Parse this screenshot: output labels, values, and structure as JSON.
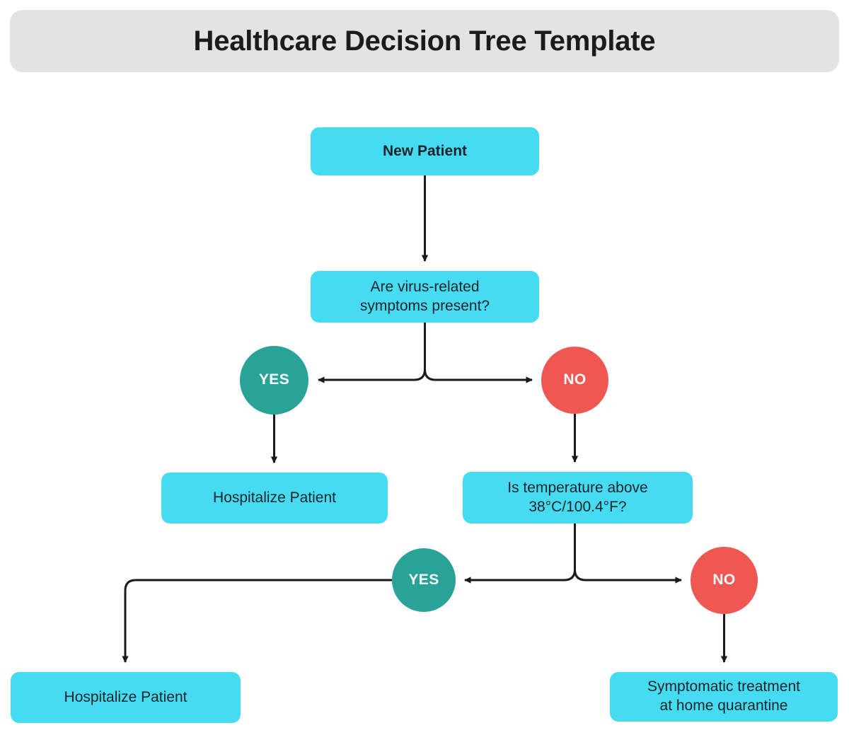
{
  "header": {
    "title": "Healthcare Decision Tree Template"
  },
  "colors": {
    "banner_background": "#E3E3E3",
    "process_node": "#45DCF2",
    "yes_node": "#29A298",
    "no_node": "#EE5752",
    "edge": "#1A1A1A",
    "text_dark": "#18222B",
    "text_light": "#FFFFFF",
    "page_background": "#FFFFFF"
  },
  "chart_data": {
    "type": "flowchart",
    "title": "Healthcare Decision Tree Template",
    "orientation": "top-down",
    "nodes": [
      {
        "id": "new_patient",
        "label": "New Patient",
        "shape": "rounded-rect",
        "role": "start",
        "color": "#45DCF2",
        "bold": true,
        "lines": [
          "New Patient"
        ]
      },
      {
        "id": "symptoms_q",
        "label": "Are virus-related symptoms present?",
        "shape": "rounded-rect",
        "role": "question",
        "color": "#45DCF2",
        "bold": false,
        "lines": [
          "Are virus-related",
          "symptoms present?"
        ]
      },
      {
        "id": "yes_1",
        "label": "YES",
        "shape": "circle",
        "role": "branch",
        "color": "#29A298",
        "bold": true,
        "lines": [
          "YES"
        ]
      },
      {
        "id": "no_1",
        "label": "NO",
        "shape": "circle",
        "role": "branch",
        "color": "#EE5752",
        "bold": true,
        "lines": [
          "NO"
        ]
      },
      {
        "id": "hospitalize_1",
        "label": "Hospitalize Patient",
        "shape": "rounded-rect",
        "role": "outcome",
        "color": "#45DCF2",
        "bold": false,
        "lines": [
          "Hospitalize Patient"
        ]
      },
      {
        "id": "temp_q",
        "label": "Is temperature above 38°C/100.4°F?",
        "shape": "rounded-rect",
        "role": "question",
        "color": "#45DCF2",
        "bold": false,
        "lines": [
          "Is temperature above",
          "38°C/100.4°F?"
        ]
      },
      {
        "id": "yes_2",
        "label": "YES",
        "shape": "circle",
        "role": "branch",
        "color": "#29A298",
        "bold": true,
        "lines": [
          "YES"
        ]
      },
      {
        "id": "no_2",
        "label": "NO",
        "shape": "circle",
        "role": "branch",
        "color": "#EE5752",
        "bold": true,
        "lines": [
          "NO"
        ]
      },
      {
        "id": "hospitalize_2",
        "label": "Hospitalize Patient",
        "shape": "rounded-rect",
        "role": "outcome",
        "color": "#45DCF2",
        "bold": false,
        "lines": [
          "Hospitalize Patient"
        ]
      },
      {
        "id": "symptomatic",
        "label": "Symptomatic treatment at home quarantine",
        "shape": "rounded-rect",
        "role": "outcome",
        "color": "#45DCF2",
        "bold": false,
        "lines": [
          "Symptomatic treatment",
          "at home quarantine"
        ]
      }
    ],
    "edges": [
      {
        "from": "new_patient",
        "to": "symptoms_q",
        "label": "",
        "style": "straight-down"
      },
      {
        "from": "symptoms_q",
        "to": "yes_1",
        "label": "",
        "style": "split-left"
      },
      {
        "from": "symptoms_q",
        "to": "no_1",
        "label": "",
        "style": "split-right"
      },
      {
        "from": "yes_1",
        "to": "hospitalize_1",
        "label": "",
        "style": "straight-down"
      },
      {
        "from": "no_1",
        "to": "temp_q",
        "label": "",
        "style": "straight-down"
      },
      {
        "from": "temp_q",
        "to": "yes_2",
        "label": "",
        "style": "split-left"
      },
      {
        "from": "temp_q",
        "to": "no_2",
        "label": "",
        "style": "split-right"
      },
      {
        "from": "yes_2",
        "to": "hospitalize_2",
        "label": "",
        "style": "elbow-left-down"
      },
      {
        "from": "no_2",
        "to": "symptomatic",
        "label": "",
        "style": "straight-down"
      }
    ]
  },
  "nodes": {
    "new_patient": {
      "text": "New Patient"
    },
    "symptoms_q": {
      "line1": "Are virus-related",
      "line2": "symptoms present?"
    },
    "yes_1": {
      "text": "YES"
    },
    "no_1": {
      "text": "NO"
    },
    "hospitalize_1": {
      "text": "Hospitalize Patient"
    },
    "temp_q": {
      "line1": "Is temperature above",
      "line2": "38°C/100.4°F?"
    },
    "yes_2": {
      "text": "YES"
    },
    "no_2": {
      "text": "NO"
    },
    "hospitalize_2": {
      "text": "Hospitalize Patient"
    },
    "symptomatic": {
      "line1": "Symptomatic treatment",
      "line2": "at home quarantine"
    }
  }
}
